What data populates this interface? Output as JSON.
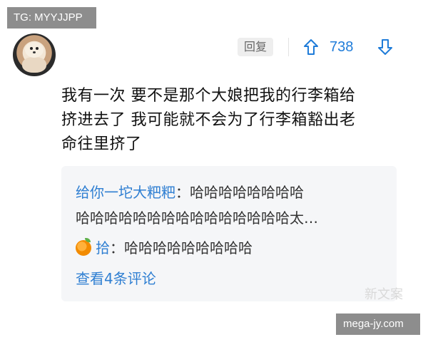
{
  "watermark": {
    "top_left": "TG: MYYJJPP",
    "bottom_text": "新文案",
    "bottom_right": "mega-jy.com"
  },
  "comment": {
    "actions": {
      "reply_label": "回复",
      "upvote_count": "738"
    },
    "text_lines": [
      "我有一次 要不是那个大娘把我的行李箱给",
      "挤进去了 我可能就不会为了行李箱豁出老",
      "命往里挤了"
    ]
  },
  "replies": {
    "items": [
      {
        "author": "给你一坨大粑粑",
        "text_line_1": "：哈哈哈哈哈哈哈哈",
        "text_line_2": "哈哈哈哈哈哈哈哈哈哈哈哈哈哈哈太…"
      },
      {
        "icon": "orange-icon",
        "author": "拾",
        "text": "：哈哈哈哈哈哈哈哈哈"
      }
    ],
    "more_label": "查看4条评论"
  },
  "colors": {
    "accent": "#1f7cd9",
    "reply_bg": "#f5f6f8",
    "button_bg": "#eeeeee"
  }
}
